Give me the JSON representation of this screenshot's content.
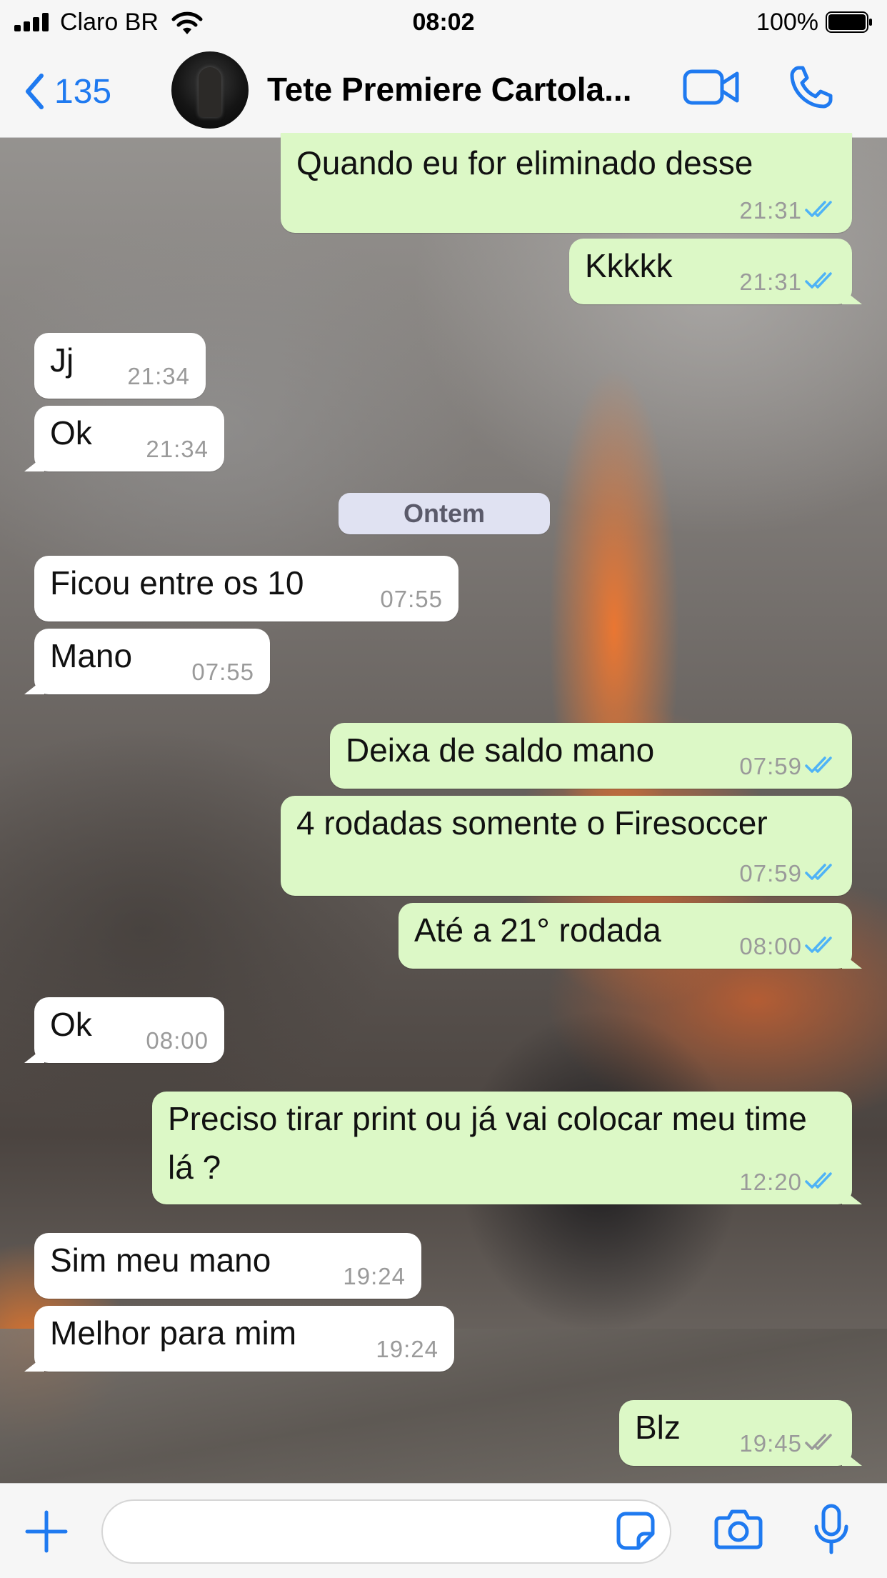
{
  "status_bar": {
    "carrier": "Claro BR",
    "time": "08:02",
    "battery": "100%"
  },
  "header": {
    "back_count": "135",
    "chat_title": "Tete Premiere Cartola...",
    "accent_color": "#1f7af0"
  },
  "date_divider": "Ontem",
  "messages": [
    {
      "direction": "out",
      "text": "Quando eu for eliminado desse",
      "time": "21:31",
      "status": "read"
    },
    {
      "direction": "out",
      "text": "Kkkkk",
      "time": "21:31",
      "status": "read"
    },
    {
      "direction": "in",
      "text": "Jj",
      "time": "21:34"
    },
    {
      "direction": "in",
      "text": "Ok",
      "time": "21:34"
    },
    {
      "direction": "in",
      "text": "Ficou entre os 10",
      "time": "07:55"
    },
    {
      "direction": "in",
      "text": "Mano",
      "time": "07:55"
    },
    {
      "direction": "out",
      "text": "Deixa de saldo mano",
      "time": "07:59",
      "status": "read"
    },
    {
      "direction": "out",
      "text": "4 rodadas somente o Firesoccer",
      "time": "07:59",
      "status": "read"
    },
    {
      "direction": "out",
      "text": "Até a 21° rodada",
      "time": "08:00",
      "status": "read"
    },
    {
      "direction": "in",
      "text": "Ok",
      "time": "08:00"
    },
    {
      "direction": "out",
      "text": "Preciso tirar print ou já vai colocar meu time lá ?",
      "time": "12:20",
      "status": "read"
    },
    {
      "direction": "in",
      "text": "Sim meu mano",
      "time": "19:24"
    },
    {
      "direction": "in",
      "text": "Melhor para mim",
      "time": "19:24"
    },
    {
      "direction": "out",
      "text": "Blz",
      "time": "19:45",
      "status": "delivered"
    }
  ],
  "composer": {
    "input_value": "",
    "input_placeholder": ""
  },
  "colors": {
    "incoming_bubble": "#ffffff",
    "outgoing_bubble": "#dcf8c6",
    "read_ticks": "#4fb3f6",
    "delivered_ticks": "#9a9a9a"
  }
}
